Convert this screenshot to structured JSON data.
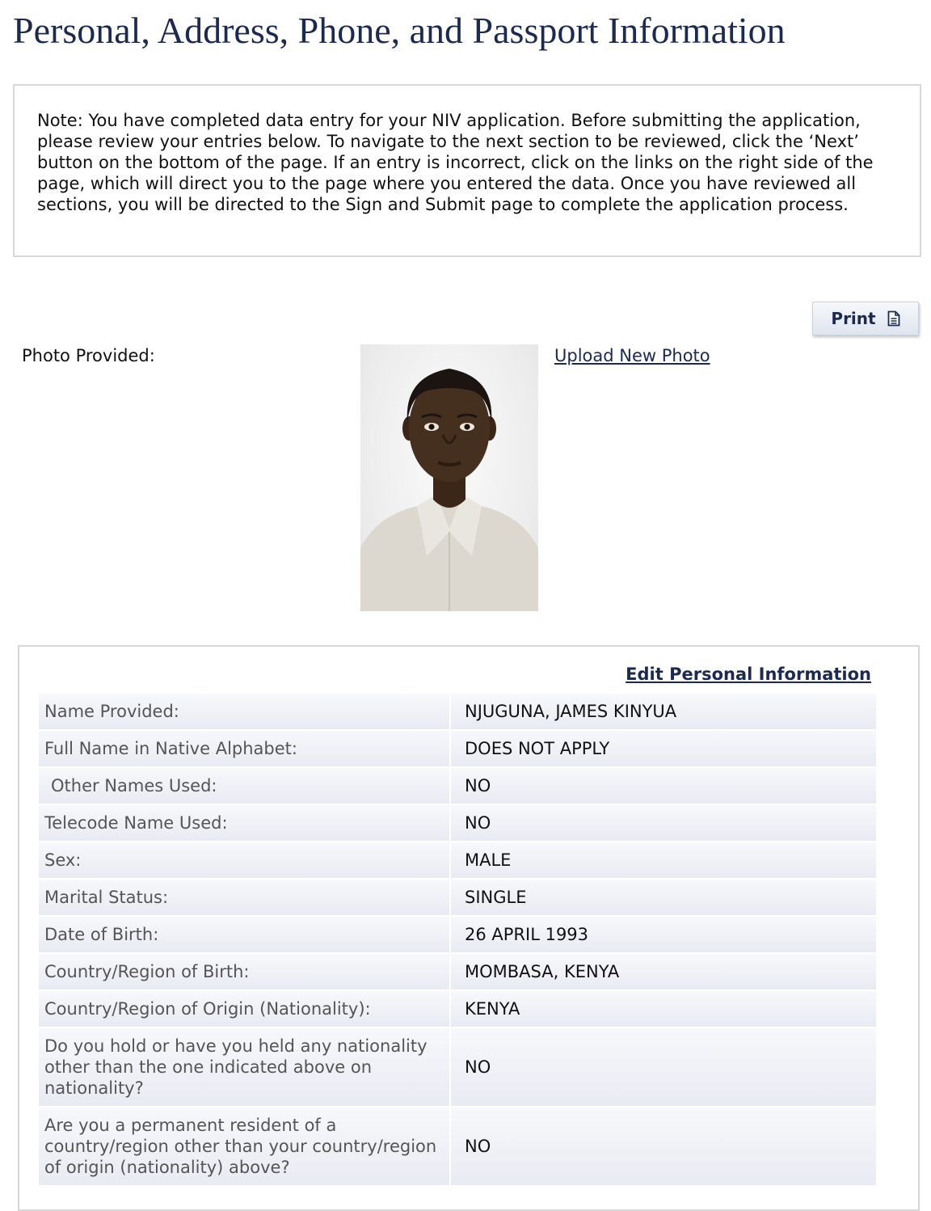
{
  "page": {
    "title": "Personal, Address, Phone, and Passport Information"
  },
  "note": {
    "text": "Note: You have completed data entry for your NIV application. Before submitting the application, please review your entries below. To navigate to the next section to be reviewed, click the ‘Next’ button on the bottom of the page. If an entry is incorrect, click on the links on the right side of the page, which will direct you to the page where you entered the data. Once you have reviewed all sections, you will be directed to the Sign and Submit page to complete the application process."
  },
  "toolbar": {
    "print_label": "Print",
    "print_icon": "document-icon"
  },
  "photo": {
    "label": "Photo Provided:",
    "upload_link": "Upload New Photo"
  },
  "personal": {
    "edit_link": "Edit Personal Information",
    "rows": [
      {
        "label": "Name Provided:",
        "value": "NJUGUNA, JAMES KINYUA"
      },
      {
        "label": "Full Name in Native Alphabet:",
        "value": "DOES NOT APPLY"
      },
      {
        "label": "Other Names Used:",
        "value": "NO"
      },
      {
        "label": "Telecode Name Used:",
        "value": "NO"
      },
      {
        "label": "Sex:",
        "value": "MALE"
      },
      {
        "label": "Marital Status:",
        "value": "SINGLE"
      },
      {
        "label": "Date of Birth:",
        "value": "26 APRIL 1993"
      },
      {
        "label": "Country/Region of Birth:",
        "value": "MOMBASA, KENYA"
      },
      {
        "label": "Country/Region of Origin (Nationality):",
        "value": "KENYA"
      },
      {
        "label": "Do you hold or have you held any nationality other than the one indicated above on nationality?",
        "value": "NO"
      },
      {
        "label": "Are you a permanent resident of a country/region other than your country/region of origin (nationality) above?",
        "value": "NO"
      }
    ]
  },
  "colors": {
    "heading": "#1c2a52",
    "label_text": "#555555",
    "row_band_top": "#f7f8fb",
    "row_band_bottom": "#e9ebf3",
    "border": "#d8d8d8"
  }
}
